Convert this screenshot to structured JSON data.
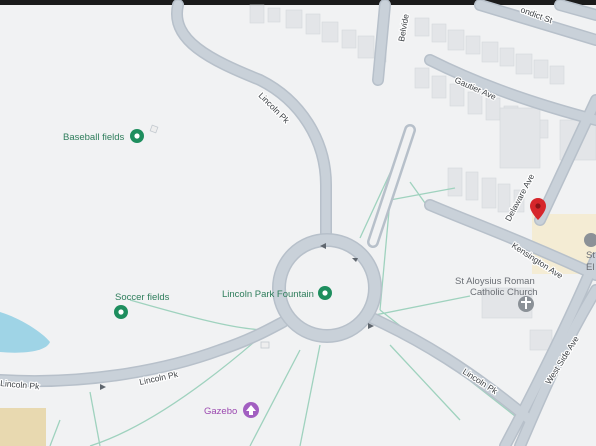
{
  "map": {
    "colors": {
      "background": "#f1f2f3",
      "road": "#c9d1d9",
      "road_edge": "#b7c0ca",
      "building": "#e3e5e8",
      "park_path": "#9fd2be",
      "water": "#9fd4e6",
      "park_poi": "#1e8e5e",
      "gazebo_poi": "#a25fc1",
      "pin": "#d6262b"
    },
    "pois": {
      "baseball": {
        "label": "Baseball fields",
        "icon": "park-icon"
      },
      "soccer": {
        "label": "Soccer fields",
        "icon": "park-icon"
      },
      "fountain": {
        "label": "Lincoln Park Fountain",
        "icon": "park-icon"
      },
      "church": {
        "label_line1": "St Aloysius Roman",
        "label_line2": "Catholic Church",
        "icon": "church-icon"
      },
      "gazebo": {
        "label": "Gazebo",
        "icon": "gazebo-icon"
      },
      "school": {
        "label_line1": "St",
        "label_line2": "El",
        "icon": "school-icon"
      }
    },
    "streets": {
      "lincoln_pk_north": "Lincoln Pk",
      "lincoln_pk_west_a": "Lincoln Pk",
      "lincoln_pk_west_b": "Lincoln Pk",
      "lincoln_pk_east": "Lincoln Pk",
      "kensington": "Kensington Ave",
      "west_side": "West Side Ave",
      "delaware": "Delaware Ave",
      "gautier": "Gautier Ave",
      "belvidere": "Belvide",
      "condict": "ondict St"
    },
    "marker": {
      "icon": "map-pin-icon"
    }
  }
}
